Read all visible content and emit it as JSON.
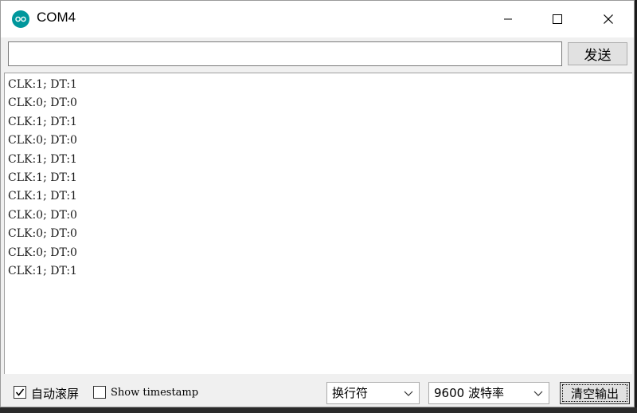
{
  "window": {
    "title": "COM4"
  },
  "send": {
    "input_value": "",
    "button_label": "发送"
  },
  "output_lines": [
    "CLK:1; DT:1",
    "CLK:0; DT:0",
    "CLK:1; DT:1",
    "CLK:0; DT:0",
    "CLK:1; DT:1",
    "CLK:1; DT:1",
    "CLK:1; DT:1",
    "CLK:0; DT:0",
    "CLK:0; DT:0",
    "CLK:0; DT:0",
    "CLK:1; DT:1"
  ],
  "bottom": {
    "autoscroll_label": "自动滚屏",
    "autoscroll_checked": true,
    "timestamp_label": "Show timestamp",
    "timestamp_checked": false,
    "line_ending": "换行符",
    "baud_rate": "9600 波特率",
    "clear_label": "清空输出"
  },
  "colors": {
    "brand": "#00979c"
  },
  "icons": [
    "arduino-logo-icon",
    "minimize-icon",
    "maximize-icon",
    "close-icon",
    "chevron-down-icon",
    "checkmark-icon"
  ]
}
